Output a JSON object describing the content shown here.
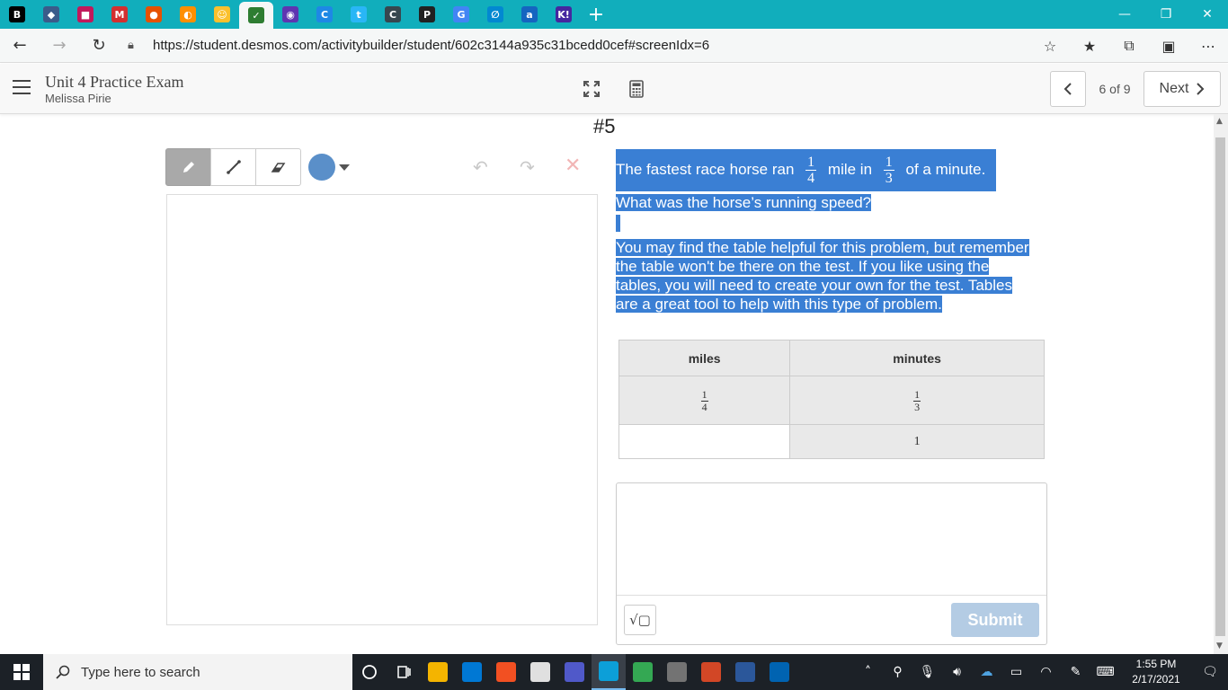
{
  "browser": {
    "url": "https://student.desmos.com/activitybuilder/student/602c3144a935c31bcedd0cef#screenIdx=6",
    "tabs": [
      {
        "glyph": "B",
        "color": "#000000"
      },
      {
        "glyph": "◆",
        "color": "#3b5b8a"
      },
      {
        "glyph": "■",
        "color": "#c2185b"
      },
      {
        "glyph": "M",
        "color": "#d32f2f"
      },
      {
        "glyph": "●",
        "color": "#e65100"
      },
      {
        "glyph": "◐",
        "color": "#ff8f00"
      },
      {
        "glyph": "☺",
        "color": "#fbc02d"
      },
      {
        "glyph": "✓",
        "color": "#2e7d32"
      },
      {
        "glyph": "◉",
        "color": "#5e35b1"
      },
      {
        "glyph": "C",
        "color": "#1e88e5"
      },
      {
        "glyph": "t",
        "color": "#29b6f6"
      },
      {
        "glyph": "C",
        "color": "#37474f"
      },
      {
        "glyph": "P",
        "color": "#212121"
      },
      {
        "glyph": "G",
        "color": "#4285f4"
      },
      {
        "glyph": "∅",
        "color": "#0288d1"
      },
      {
        "glyph": "a",
        "color": "#1565c0"
      },
      {
        "glyph": "K!",
        "color": "#4527a0"
      }
    ]
  },
  "header": {
    "title": "Unit 4 Practice Exam",
    "teacher": "Melissa Pirie",
    "page_indicator": "6 of 9",
    "next_label": "Next"
  },
  "screen": {
    "title": "#5",
    "prompt_part1": "The fastest race horse ran",
    "frac1_num": "1",
    "frac1_den": "4",
    "prompt_part2": "mile in",
    "frac2_num": "1",
    "frac2_den": "3",
    "prompt_part3": "of a minute.",
    "question": "What was the horse’s running speed?",
    "note": "You may find the table helpful for this problem, but remember the table won't be there on the test.  If you like using the tables, you will need to create your own for the test.  Tables are a great tool to help with this type of problem."
  },
  "table": {
    "headers": [
      "miles",
      "minutes"
    ],
    "row1": {
      "miles_num": "1",
      "miles_den": "4",
      "minutes_num": "1",
      "minutes_den": "3"
    },
    "row2": {
      "miles": "",
      "minutes": "1"
    }
  },
  "answer": {
    "math_button": "√▢",
    "submit_label": "Submit"
  },
  "taskbar": {
    "search_placeholder": "Type here to search",
    "time": "1:55 PM",
    "date": "2/17/2021",
    "apps": [
      {
        "name": "file-explorer",
        "color": "#f4b400"
      },
      {
        "name": "mail",
        "color": "#0078d4"
      },
      {
        "name": "store",
        "color": "#f25022"
      },
      {
        "name": "clock-app",
        "color": "#e0e0e0"
      },
      {
        "name": "teams",
        "color": "#5059c9"
      },
      {
        "name": "edge",
        "color": "#0c9fd8"
      },
      {
        "name": "chrome",
        "color": "#34a853"
      },
      {
        "name": "calculator",
        "color": "#737373"
      },
      {
        "name": "powerpoint",
        "color": "#d24726"
      },
      {
        "name": "word",
        "color": "#2b579a"
      },
      {
        "name": "photos",
        "color": "#0063b1"
      }
    ]
  },
  "colors": {
    "tab_strip": "#11aebc",
    "selection": "#3a7fd4",
    "pen_color": "#5a8fc9",
    "submit_disabled": "#b4cce4"
  }
}
